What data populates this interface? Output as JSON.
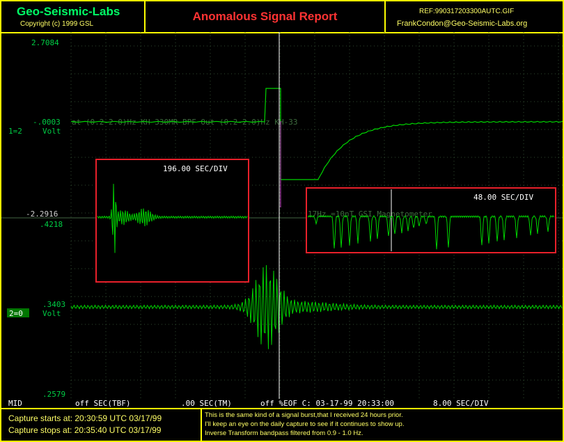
{
  "header": {
    "brand": "Geo-Seismic-Labs",
    "copyright": "Copyright (c) 1999 GSL",
    "report_title": "Anomalous Signal Report",
    "ref": "REF:990317203300AUTC.GIF",
    "email": "FrankCondon@Geo-Seismic-Labs.org"
  },
  "scope": {
    "ch1_labels": [
      "2.7084",
      "-.0003",
      "Volt",
      "1=2",
      "-2.2916"
    ],
    "ch2_labels": [
      ".4218",
      ".3403",
      "Volt",
      "2=0",
      ".2579"
    ],
    "ch1_trace_caption": "at (0.2-2.0)Hz      KH 330MR BPF Out (0.2-2.0)Hz      KH-33",
    "ch2_trace_caption": "17Hz =10nT      GSI Magnetometer",
    "inset_left_div": "196.00 SEC/DIV",
    "inset_right_div": "48.00 SEC/DIV"
  },
  "status_bar": {
    "mid": "MID",
    "tbf": "off SEC(TBF)",
    "tm": ".00 SEC(TM)",
    "eof": "off %EOF C: 03-17-99 20:33:00",
    "div": "8.00 SEC/DIV"
  },
  "footer": {
    "capture_start": "Capture starts at: 20:30:59 UTC 03/17/99",
    "capture_stop": "Capture stops at: 20:35:40 UTC 03/17/99",
    "notes": [
      "This is the same kind of a signal burst,that I received 24 hours prior.",
      "I'll keep an eye on the daily capture to see if it continues to show up.",
      "Inverse Transform bandpass filtered from 0.9 - 1.0 Hz."
    ]
  },
  "colors": {
    "frame": "#ffff00",
    "trace": "#00d400",
    "title": "#ff3333",
    "inset_border": "#e8202a",
    "grid": "#3a5a3a"
  }
}
